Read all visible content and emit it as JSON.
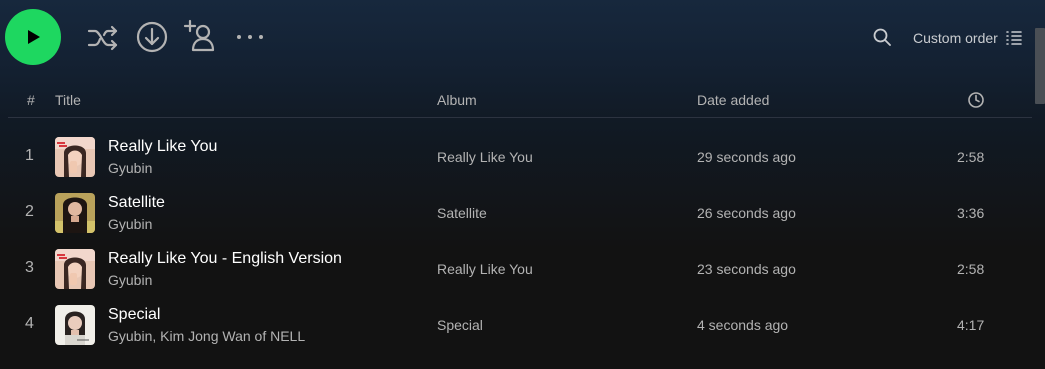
{
  "toolbar": {
    "icons": [
      "play-icon",
      "shuffle-icon",
      "download-icon",
      "add-user-icon",
      "more-icon",
      "search-icon",
      "list-icon"
    ],
    "sort_label": "Custom order",
    "accent": "#1ed760"
  },
  "header": {
    "num": "#",
    "title": "Title",
    "album": "Album",
    "date_added": "Date added",
    "duration_icon": "clock-icon"
  },
  "tracks": [
    {
      "num": "1",
      "title": "Really Like You",
      "artist": "Gyubin",
      "album": "Really Like You",
      "date_added": "29 seconds ago",
      "duration": "2:58"
    },
    {
      "num": "2",
      "title": "Satellite",
      "artist": "Gyubin",
      "album": "Satellite",
      "date_added": "26 seconds ago",
      "duration": "3:36"
    },
    {
      "num": "3",
      "title": "Really Like You - English Version",
      "artist": "Gyubin",
      "album": "Really Like You",
      "date_added": "23 seconds ago",
      "duration": "2:58"
    },
    {
      "num": "4",
      "title": "Special",
      "artist": "Gyubin, Kim Jong Wan of NELL",
      "album": "Special",
      "date_added": "4 seconds ago",
      "duration": "4:17"
    }
  ]
}
